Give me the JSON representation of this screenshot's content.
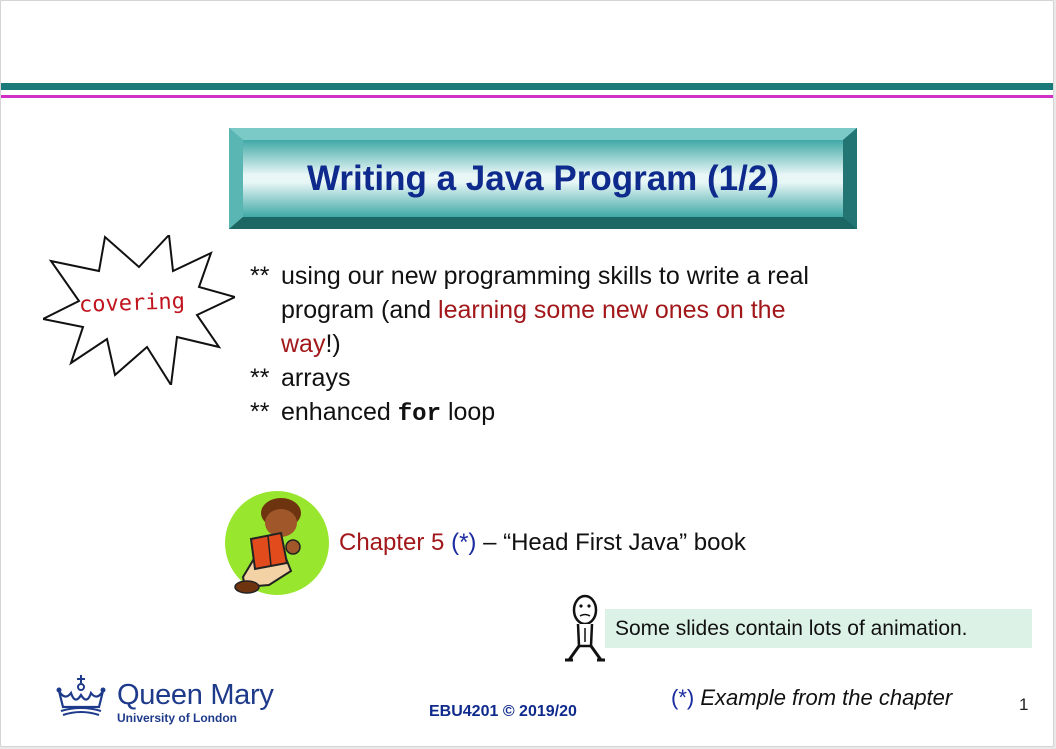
{
  "slide": {
    "title": "Writing a Java Program (1/2)",
    "starburst_label": "covering",
    "bullets": [
      {
        "mark": "**",
        "text_1": "using our new programming skills to write a real program (and ",
        "text_red": "learning some new ones on the way",
        "text_2": "!)"
      },
      {
        "mark": "**",
        "text": "arrays"
      },
      {
        "mark": "**",
        "text_1": "enhanced ",
        "code": "for",
        "text_2": " loop"
      }
    ],
    "chapter": {
      "label": "Chapter 5",
      "ref": "(*)",
      "rest": " – “Head First Java” book"
    },
    "animation_note": "Some slides contain lots of animation.",
    "footer": {
      "logo_main": "Queen Mary",
      "logo_sub": "University of London",
      "course": "EBU4201 © 2019/20",
      "note_star": "(*)",
      "note_text": " Example from the chapter",
      "page_number": "1"
    }
  },
  "colors": {
    "title": "#0e2a8c",
    "accent_red": "#a2171a",
    "teal_band": "#1a7a7a",
    "magenta_band": "#d22fc6",
    "note_bg": "#ddf2e6"
  },
  "icons": [
    "starburst-icon",
    "reading-person-icon",
    "stick-figure-icon",
    "crown-crest-icon"
  ]
}
